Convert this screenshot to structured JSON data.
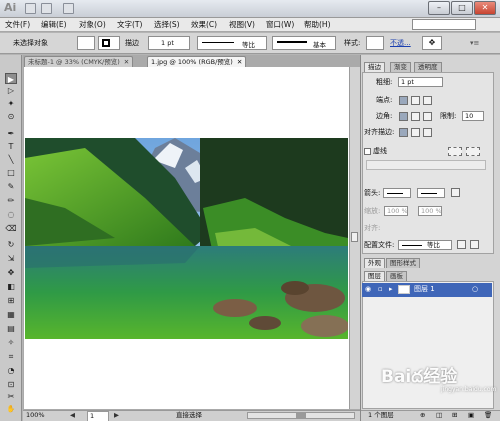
{
  "app": {
    "logo": "Ai"
  },
  "window_controls": {
    "minimize": "–",
    "maximize": "□",
    "close": "✕"
  },
  "menu": [
    "文件(F)",
    "编辑(E)",
    "对象(O)",
    "文字(T)",
    "选择(S)",
    "效果(C)",
    "视图(V)",
    "窗口(W)",
    "帮助(H)"
  ],
  "control_bar": {
    "selection_label": "未选择对象",
    "stroke_label": "描边",
    "stroke_weight": "1 pt",
    "profile_label": "等比",
    "brush_label": "基本",
    "style_label": "样式:",
    "opacity_link": "不透..."
  },
  "tabs": [
    {
      "label": "未标题-1 @ 33% (CMYK/预览)",
      "close": "✕"
    },
    {
      "label": "1.jpg @ 100% (RGB/预览)",
      "close": "✕"
    }
  ],
  "tools": [
    "▶",
    "▷",
    "✦",
    "⊙",
    "✒",
    "T",
    "╲",
    "□",
    "✎",
    "✏",
    "◌",
    "⌫",
    "↻",
    "⇲",
    "✥",
    "◧",
    "⊞",
    "▦",
    "▤",
    "✧",
    "⌗",
    "◔",
    "⊡",
    "✂",
    "✋",
    "🔍"
  ],
  "stroke_panel": {
    "tabs": [
      "描边",
      "渐变",
      "透明度"
    ],
    "weight_label": "粗细:",
    "weight_value": "1 pt",
    "cap_label": "端点:",
    "corner_label": "边角:",
    "limit_label": "限制:",
    "limit_value": "10",
    "align_label": "对齐描边:",
    "dashed_label": "虚线",
    "arrow_label": "箭头:",
    "scale_label": "缩放:",
    "scale_value": "100 %",
    "align2_label": "对齐:",
    "profile_label": "配置文件:",
    "profile_value": "等比"
  },
  "appearance_tabs": [
    "外观",
    "图形样式"
  ],
  "layers_panel": {
    "tabs": [
      "图层",
      "画板"
    ],
    "layer_name": "图层 1",
    "footer": "1 个图层"
  },
  "status": {
    "zoom": "100%",
    "page": "1",
    "tool": "直接选择"
  },
  "watermark": {
    "text": "Baiద经验",
    "sub": "jingyan.baidu.com"
  }
}
